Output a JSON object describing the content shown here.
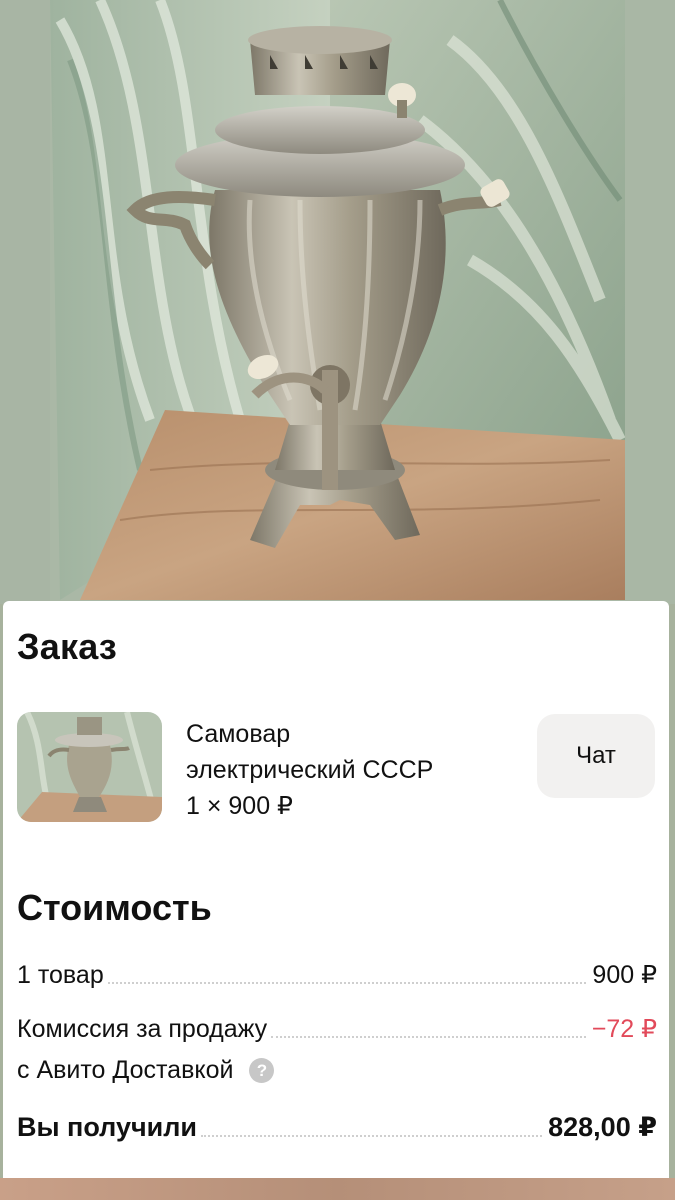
{
  "order": {
    "title": "Заказ",
    "item": {
      "name_line1": "Самовар",
      "name_line2": "электрический СССР",
      "quantity_price": "1 × 900 ₽"
    },
    "chat_label": "Чат"
  },
  "cost": {
    "title": "Стоимость",
    "rows": [
      {
        "label": "1 товар",
        "amount": "900 ₽"
      },
      {
        "label_line1": "Комиссия за продажу",
        "label_line2": "с Авито Доставкой",
        "amount": "−72 ₽"
      },
      {
        "label": "Вы получили",
        "amount": "828,00 ₽"
      }
    ],
    "help_icon_glyph": "?"
  },
  "colors": {
    "negative": "#e24a5a",
    "chat_button_bg": "#f2f1f0",
    "help_icon_bg": "#c7c7c7"
  }
}
